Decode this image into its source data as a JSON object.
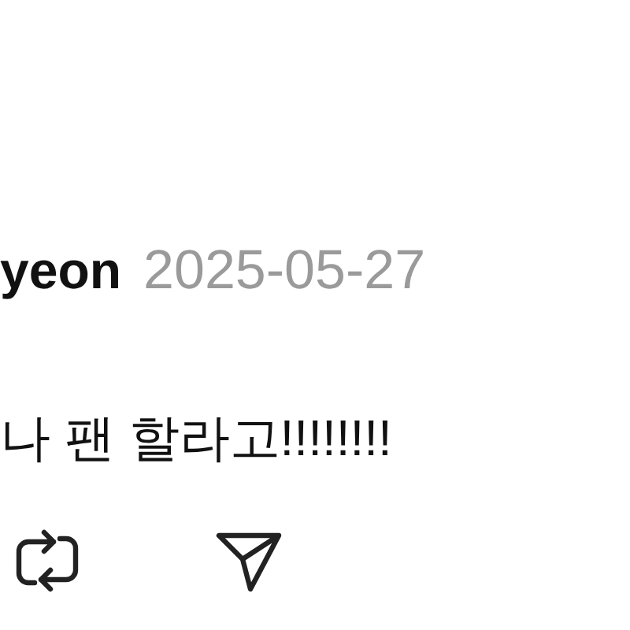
{
  "post": {
    "username": "yeon",
    "date": "2025-05-27",
    "text": "나 팬 할라고!!!!!!!!"
  }
}
